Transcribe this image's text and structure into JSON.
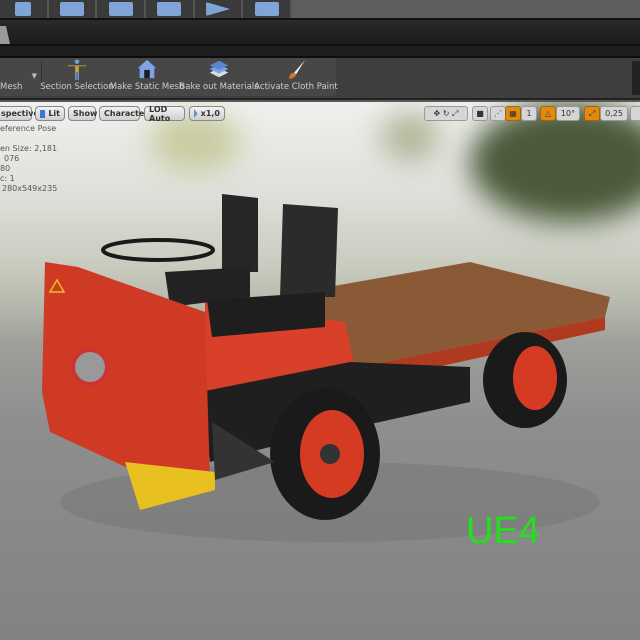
{
  "top_toolbar": {
    "icons": [
      "save-icon",
      "content-icon",
      "marketplace-icon",
      "settings-icon",
      "blueprint-icon",
      "cinematics-icon",
      "build-icon",
      "play-icon",
      "launch-icon"
    ]
  },
  "mesh_toolbar": {
    "items": [
      {
        "label": "Mesh",
        "icon": "dropdown-icon"
      },
      {
        "label": "Section Selection",
        "icon": "character-pose-icon"
      },
      {
        "label": "Make Static Mesh",
        "icon": "house-icon"
      },
      {
        "label": "Bake out Materials",
        "icon": "layers-icon"
      },
      {
        "label": "Activate Cloth Paint",
        "icon": "brush-icon"
      }
    ]
  },
  "viewport": {
    "left_buttons": [
      {
        "label": "spective"
      },
      {
        "label": "Lit",
        "icon": "lit-cube-icon"
      },
      {
        "label": "Show"
      },
      {
        "label": "Character"
      },
      {
        "label": "LOD Auto"
      },
      {
        "label": "x1,0",
        "icon": "play-speed-icon"
      }
    ],
    "right_controls": {
      "rotation_snap": "10°",
      "scale_snap": "0,25",
      "grid_snap": "1"
    },
    "stats": [
      "eference Pose",
      "",
      "en Size: 2,181",
      "076",
      "80",
      "c: 1",
      "280x549x235"
    ],
    "watermark": "UE4",
    "watermark_color": "#22e01a"
  }
}
